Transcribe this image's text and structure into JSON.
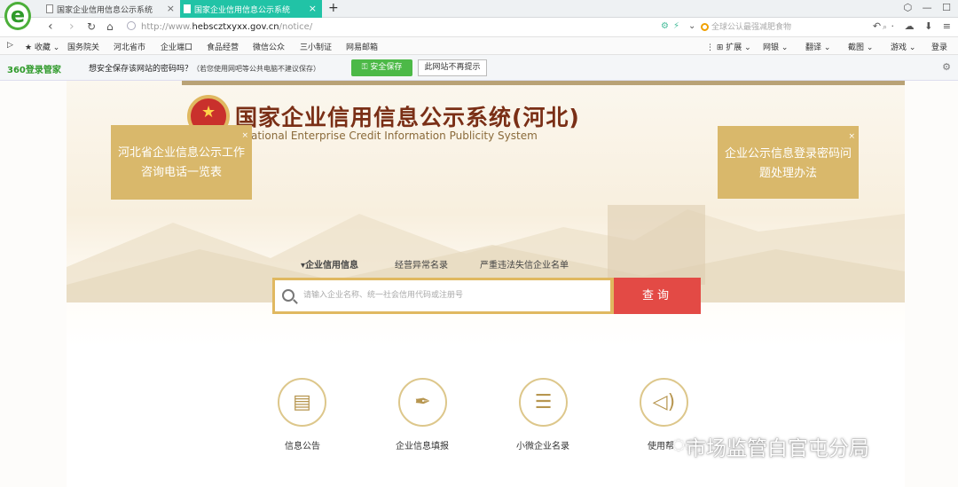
{
  "browser": {
    "tabs": [
      {
        "label": "国家企业信用信息公示系统",
        "active": false
      },
      {
        "label": "国家企业信用信息公示系统",
        "active": true
      }
    ],
    "new_tab": "+",
    "window_controls": [
      "⬡",
      "—",
      "☐"
    ],
    "url_prefix": "http://www.",
    "url_host": "hebscztxyxx.gov.cn",
    "url_path": "/notice/",
    "search_placeholder": "全球公认最强减肥食物",
    "right_controls": [
      "↶ ·",
      "☁",
      "⬇",
      "≡"
    ],
    "accent": "#21c3a6"
  },
  "bookmarks": [
    "★ 收藏 ⌄",
    "国务院关",
    "河北省市",
    "企业端口",
    "食品经营",
    "微信公众",
    "三小制证",
    "网易邮箱",
    "⋮ ⊞ 扩展 ⌄",
    "网银 ⌄",
    "翻译 ⌄",
    "截图 ⌄",
    "游戏 ⌄",
    "登录"
  ],
  "savebar": {
    "brand": "360登录管家",
    "question": "想安全保存该网站的密码吗？",
    "note": "（若您使用网吧等公共电脑不建议保存）",
    "save_btn": "安全保存",
    "dismiss_btn": "此网站不再提示"
  },
  "site": {
    "title": "国家企业信用信息公示系统(河北)",
    "subtitle": "ational Enterprise Credit Information Publicity System",
    "left_box": [
      "河北省企业信息公示工作",
      "咨询电话一览表"
    ],
    "right_box": [
      "企业公示信息登录密码问",
      "题处理办法"
    ],
    "close": "×",
    "search_tabs": [
      "▾企业信用信息",
      "经营异常名录",
      "严重违法失信企业名单"
    ],
    "search_placeholder": "请输入企业名称、统一社会信用代码或注册号",
    "search_btn": "查询",
    "icons": [
      {
        "icon": "document-icon",
        "glyph": "▤",
        "label": "信息公告"
      },
      {
        "icon": "pen-icon",
        "glyph": "✒",
        "label": "企业信息填报"
      },
      {
        "icon": "list-icon",
        "glyph": "☰",
        "label": "小微企业名录"
      },
      {
        "icon": "speaker-icon",
        "glyph": "◁)",
        "label": "使用帮"
      }
    ],
    "colors": {
      "gold": "#d9b86b",
      "red": "#e34a45",
      "brown": "#7a2f16"
    }
  },
  "watermark": "市场监管白官屯分局"
}
